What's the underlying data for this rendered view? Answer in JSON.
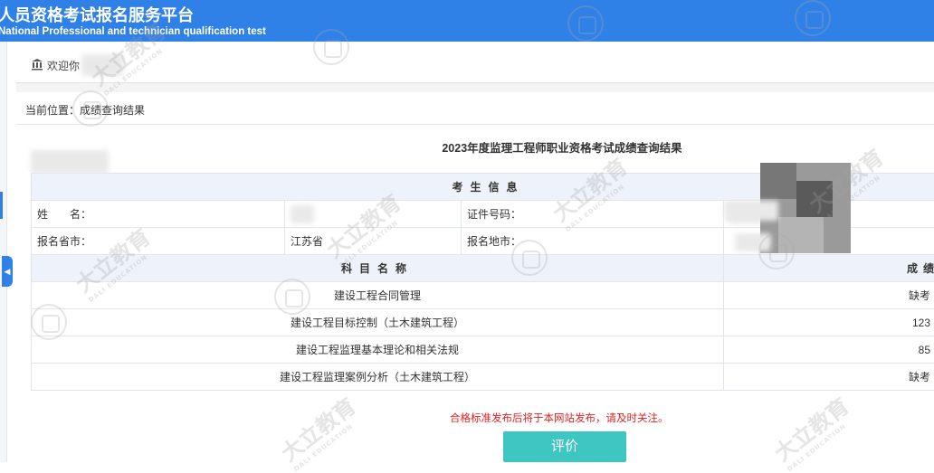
{
  "header": {
    "title": "人员资格考试报名服务平台",
    "subtitle": "National Professional and technician qualification test",
    "bg_color": "#2f80e7"
  },
  "welcome_bar": {
    "icon": "bank-icon",
    "text": "欢迎你"
  },
  "breadcrumb": {
    "text": "当前位置：成绩查询结果"
  },
  "result": {
    "title": "2023年度监理工程师职业资格考试成绩查询结果",
    "section_header": "考生信息",
    "info": {
      "name_label": "姓　　名：",
      "id_label": "证件号码：",
      "province_label": "报名省市：",
      "province_value": "江苏省",
      "site_label": "报名地市："
    },
    "subject_header": "科目名称",
    "score_header": "成绩",
    "subjects": [
      {
        "name": "建设工程合同管理",
        "score": "缺考"
      },
      {
        "name": "建设工程目标控制（土木建筑工程）",
        "score": "123"
      },
      {
        "name": "建设工程监理基本理论和相关法规",
        "score": "85"
      },
      {
        "name": "建设工程监理案例分析（土木建筑工程）",
        "score": "缺考"
      }
    ]
  },
  "notice": "合格标准发布后将于本网站发布，请及时关注。",
  "eval_button": "评价",
  "watermark": {
    "text": "大立教育",
    "sub": "DALI EDUCATION"
  }
}
